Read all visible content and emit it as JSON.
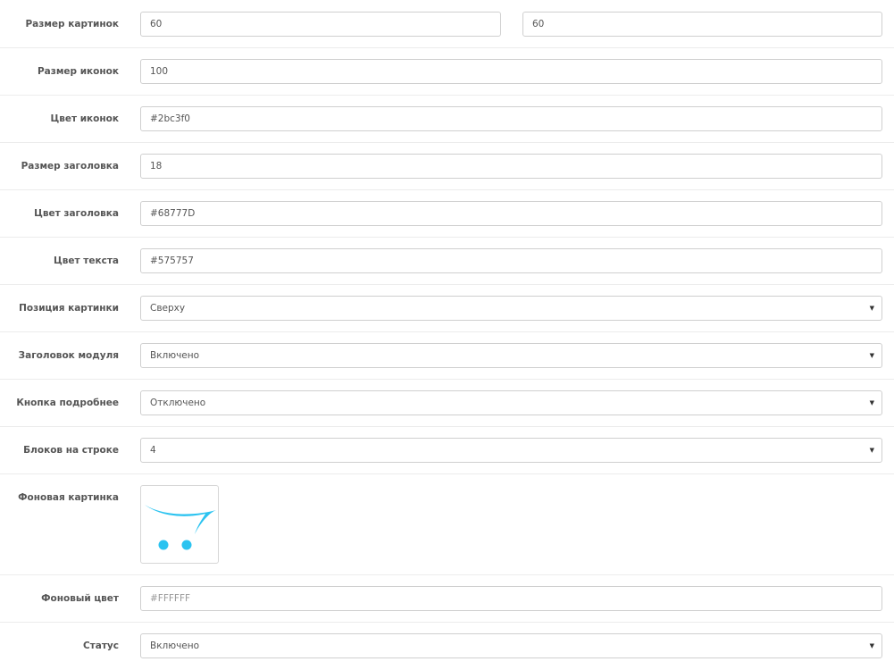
{
  "rows": {
    "image_size": {
      "label": "Размер картинок",
      "width_value": "60",
      "height_value": "60"
    },
    "icon_size": {
      "label": "Размер иконок",
      "value": "100"
    },
    "icon_color": {
      "label": "Цвет иконок",
      "value": "#2bc3f0"
    },
    "title_size": {
      "label": "Размер заголовка",
      "value": "18"
    },
    "title_color": {
      "label": "Цвет заголовка",
      "value": "#68777D"
    },
    "text_color": {
      "label": "Цвет текста",
      "value": "#575757"
    },
    "image_position": {
      "label": "Позиция картинки",
      "value": "Сверху"
    },
    "module_title": {
      "label": "Заголовок модуля",
      "value": "Включено"
    },
    "more_button": {
      "label": "Кнопка подробнее",
      "value": "Отключено"
    },
    "blocks_per_row": {
      "label": "Блоков на строке",
      "value": "4"
    },
    "background_image": {
      "label": "Фоновая картинка",
      "icon": "opencart-cart-logo",
      "logo_color": "#2bc3f0"
    },
    "background_color": {
      "label": "Фоновый цвет",
      "placeholder": "#FFFFFF"
    },
    "status": {
      "label": "Статус",
      "value": "Включено"
    }
  },
  "icons": {
    "dropdown_caret": "▼"
  }
}
